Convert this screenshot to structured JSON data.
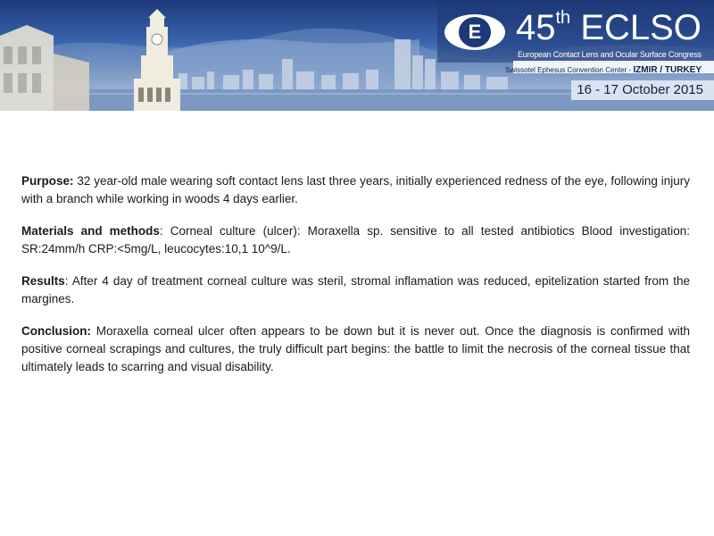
{
  "banner": {
    "logo_letter": "E",
    "title_number": "45",
    "title_suffix": "th",
    "title_name": "ECLSO",
    "subtitle": "European Contact Lens and Ocular Surface Congress",
    "venue_name": "Swissotel Ephesus Convention Center - ",
    "venue_city": "IZMIR / TURKEY",
    "dates": "16 - 17 October 2015"
  },
  "sections": [
    {
      "label": "Purpose:",
      "text": " 32 year-old male wearing soft contact lens last three years,  initially experienced redness of the eye, following injury with a branch while working in woods 4 days earlier."
    },
    {
      "label": "Materials and methods",
      "text": ": Corneal culture (ulcer): Moraxella sp. sensitive to all tested antibiotics Blood investigation: SR:24mm/h  CRP:<5mg/L, leucocytes:10,1 10^9/L."
    },
    {
      "label": "Results",
      "text": ": After 4 day of treatment corneal culture was steril, stromal inflamation was reduced, epitelization started from the margines."
    },
    {
      "label": "Conclusion:",
      "text": "  Moraxella corneal ulcer often appears to be down but it is never out. Once the diagnosis is confirmed with positive corneal scrapings and cultures, the truly difficult part begins: the battle to limit the necrosis of the corneal tissue that ultimately leads to scarring and visual disability."
    }
  ]
}
